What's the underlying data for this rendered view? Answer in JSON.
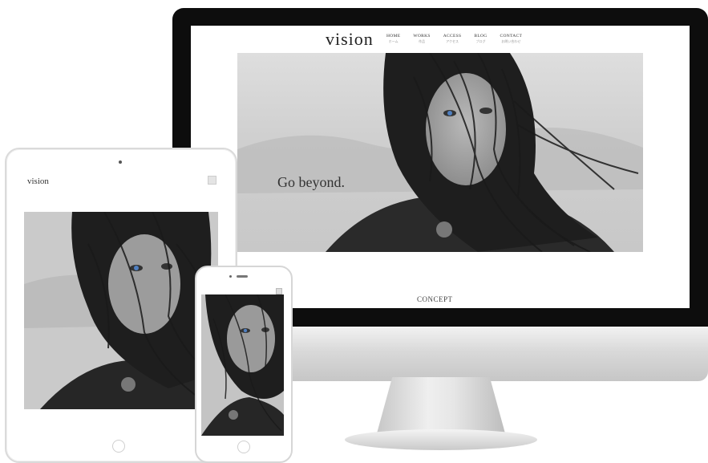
{
  "site": {
    "logo": "vision",
    "nav": [
      {
        "label": "HOME",
        "sub": "ホーム"
      },
      {
        "label": "WORKS",
        "sub": "作品"
      },
      {
        "label": "ACCESS",
        "sub": "アクセス"
      },
      {
        "label": "BLOG",
        "sub": "ブログ"
      },
      {
        "label": "CONTACT",
        "sub": "お問い合わせ"
      }
    ],
    "tagline": "Go beyond.",
    "section_title": "CONCEPT"
  },
  "colors": {
    "monitor_frame": "#0d0d0d",
    "device_silver": "#d9d9d9",
    "eye_blue": "#4f7fc0"
  }
}
